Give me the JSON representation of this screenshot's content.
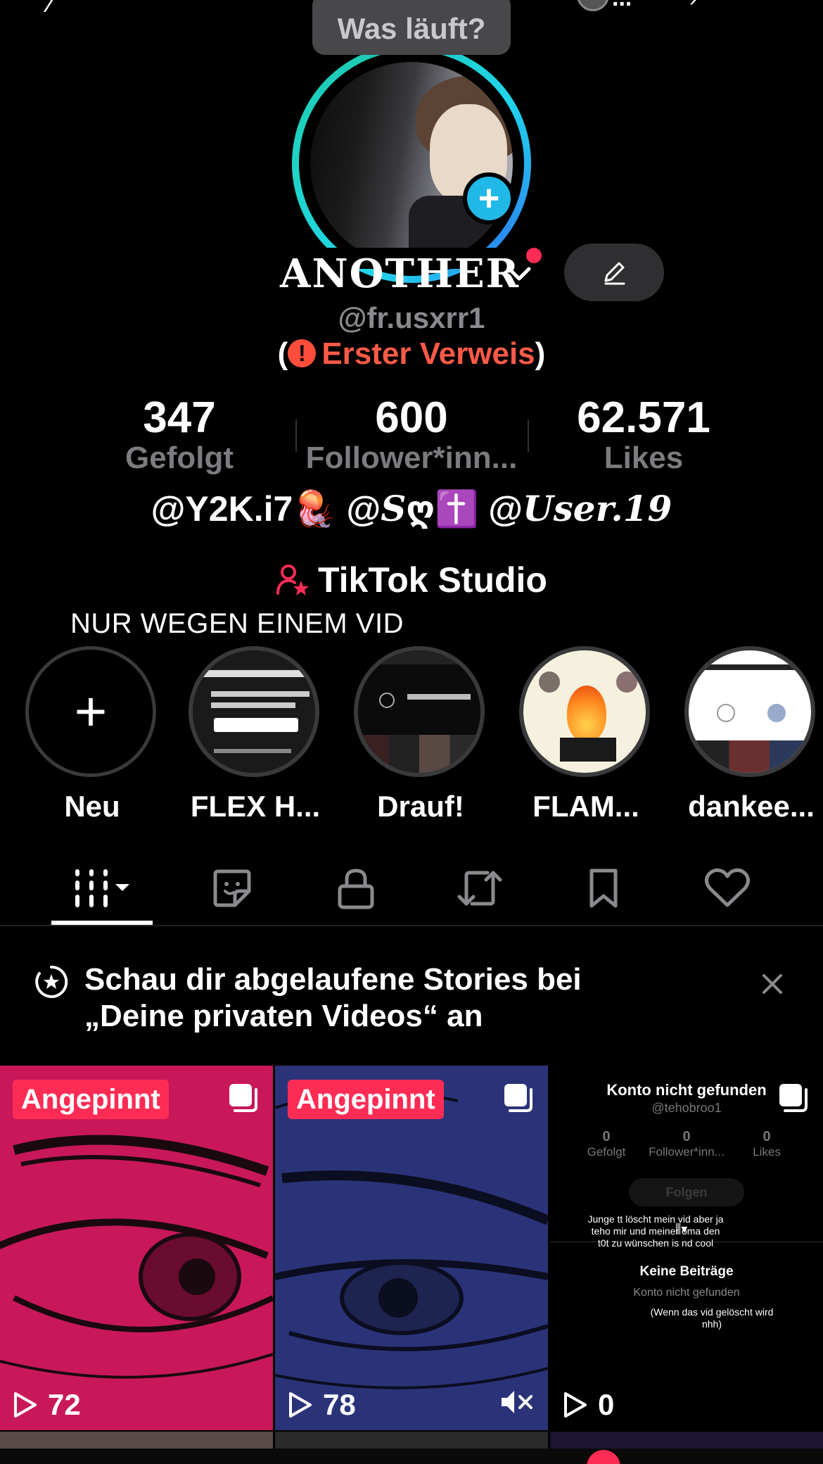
{
  "status_bubble": {
    "text": "Was läuft?"
  },
  "top_bar": {
    "ellipsis": "..."
  },
  "profile": {
    "display_name": "ANOTHER",
    "username": "@fr.usxrr1",
    "warning": {
      "open": "(",
      "icon": "!",
      "text": "Erster Verweis",
      "close": ")"
    }
  },
  "stats": [
    {
      "value": "347",
      "label": "Gefolgt"
    },
    {
      "value": "600",
      "label": "Follower*inn..."
    },
    {
      "value": "62.571",
      "label": "Likes"
    }
  ],
  "bio": {
    "mention1": "@Y2K.i7",
    "emoji1": "🪼",
    "mention2_prefix": "@",
    "mention2": "S",
    "mention2_heart": "ღ",
    "emoji2": "✝️",
    "mention3_prefix": "@",
    "mention3": "User.19"
  },
  "studio": {
    "label": "TikTok Studio"
  },
  "highlights": {
    "title": "NUR WEGEN EINEM VID",
    "items": [
      {
        "label": "Neu",
        "plus": "+"
      },
      {
        "label": "FLEX H..."
      },
      {
        "label": "Drauf!"
      },
      {
        "label": "FLAM..."
      },
      {
        "label": "dankee..."
      }
    ]
  },
  "tabs": [
    "videos-tab",
    "stickers-tab",
    "private-tab",
    "reposts-tab",
    "favorites-tab",
    "liked-tab"
  ],
  "banner": {
    "line1": "Schau dir abgelaufene Stories bei",
    "line2": "„Deine privaten Videos“ an"
  },
  "grid": [
    {
      "pinned": "Angepinnt",
      "views": "72"
    },
    {
      "pinned": "Angepinnt",
      "views": "78"
    },
    {
      "views": "0",
      "title": "Konto nicht gefunden",
      "handle": "@tehobroo1",
      "stats": [
        {
          "n": "0",
          "l": "Gefolgt"
        },
        {
          "n": "0",
          "l": "Follower*inn..."
        },
        {
          "n": "0",
          "l": "Likes"
        }
      ],
      "follow": "Folgen",
      "note": "Junge tt löscht mein vid aber ja teho mir und meiner oma den t0t zu wünschen is nd cool",
      "keine": "Keine Beiträge",
      "notfound": "Konto nicht gefunden",
      "paren": "(Wenn das vid gelöscht wird nhh)"
    }
  ],
  "colors": {
    "accent_red": "#fe2c55",
    "warning_red": "#ff5a48",
    "ring_cyan": "#20d5ec",
    "plus_blue": "#20b8e6",
    "muted_gray": "#7c7c80"
  }
}
